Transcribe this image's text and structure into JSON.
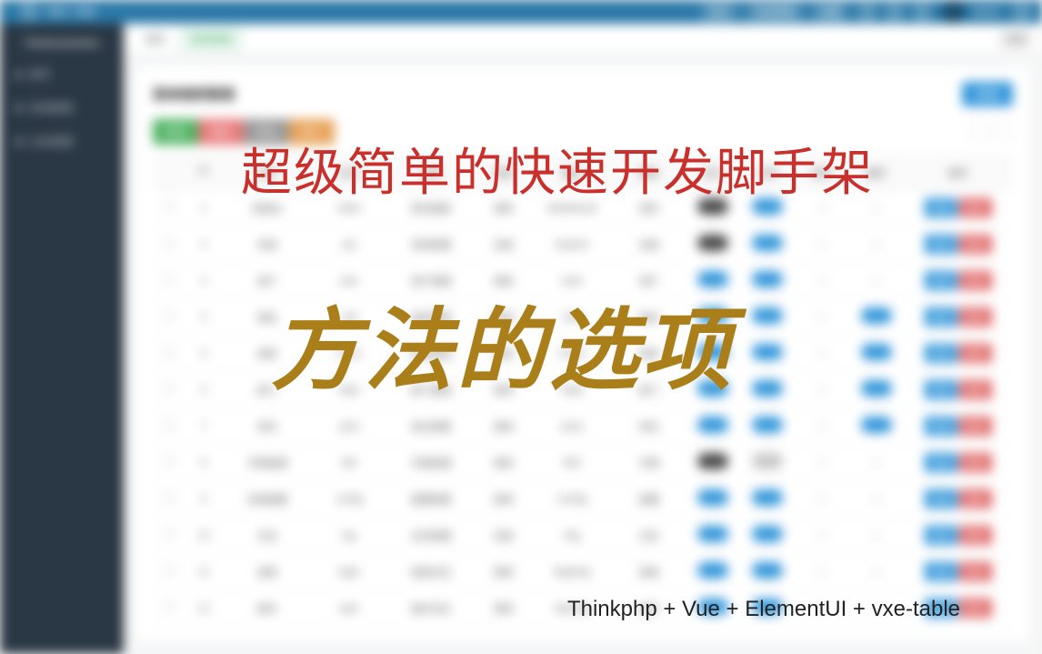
{
  "topbar": {
    "btn1": "首页",
    "btn2": "系统管理",
    "btn3": "设置",
    "username": "admin"
  },
  "sidebar": {
    "logo": "ThinkVueAdmin",
    "items": [
      "首页",
      "系统管理",
      "日志管理"
    ]
  },
  "tabs": {
    "t1": "首页",
    "t2": "菜单管理",
    "close": "关闭"
  },
  "panel": {
    "title": "菜单规则管理",
    "primary": "新增"
  },
  "toolbar": {
    "g": "新增",
    "r": "删除",
    "gr": "导出",
    "o": "导入"
  },
  "columns": [
    "",
    "ID",
    "名称",
    "标识",
    "权限",
    "类型",
    "路由",
    "图标",
    "显示",
    "状态",
    "排序",
    "缓存",
    "操作"
  ],
  "rows": [
    {
      "id": "1",
      "name": "控制台",
      "ident": "index",
      "perm": "首页面板",
      "type": "菜单",
      "route": "/dashboard",
      "icon": "首页",
      "c8": "dark",
      "c9": "on",
      "c10": "—",
      "c11": "—"
    },
    {
      "id": "2",
      "name": "系统",
      "ident": "sys",
      "perm": "系统管理",
      "type": "目录",
      "route": "/system",
      "icon": "系统",
      "c8": "dark",
      "c9": "on",
      "c10": "—",
      "c11": "—"
    },
    {
      "id": "3",
      "name": "用户",
      "ident": "user",
      "perm": "用户管理",
      "type": "菜单",
      "route": "/user",
      "icon": "用户",
      "c8": "on",
      "c9": "on",
      "c10": "—",
      "c11": "—"
    },
    {
      "id": "4",
      "name": "角色",
      "ident": "role",
      "perm": "角色管理",
      "type": "菜单",
      "route": "/role",
      "icon": "角色",
      "c8": "on",
      "c9": "on",
      "c10": "—",
      "c11": "on"
    },
    {
      "id": "5",
      "name": "菜单",
      "ident": "menu",
      "perm": "菜单管理",
      "type": "菜单",
      "route": "/menu",
      "icon": "菜单",
      "c8": "on",
      "c9": "on",
      "c10": "—",
      "c11": "on"
    },
    {
      "id": "6",
      "name": "部门",
      "ident": "dept",
      "perm": "部门管理",
      "type": "菜单",
      "route": "/dept",
      "icon": "部门",
      "c8": "on",
      "c9": "on",
      "c10": "—",
      "c11": "on"
    },
    {
      "id": "7",
      "name": "岗位",
      "ident": "post",
      "perm": "岗位管理",
      "type": "菜单",
      "route": "/post",
      "icon": "岗位",
      "c8": "on",
      "c9": "on",
      "c10": "—",
      "c11": "on"
    },
    {
      "id": "8",
      "name": "字典管理",
      "ident": "dict",
      "perm": "字典管理",
      "type": "菜单",
      "route": "/dict",
      "icon": "字典",
      "c8": "dark",
      "c9": "off",
      "c10": "—",
      "c11": "—"
    },
    {
      "id": "9",
      "name": "系统配置",
      "ident": "config",
      "perm": "配置管理",
      "type": "菜单",
      "route": "/config",
      "icon": "配置",
      "c8": "on",
      "c9": "on",
      "c10": "—",
      "c11": "—"
    },
    {
      "id": "10",
      "name": "日志",
      "ident": "log",
      "perm": "日志管理",
      "type": "目录",
      "route": "/log",
      "icon": "日志",
      "c8": "on",
      "c9": "on",
      "c10": "—",
      "c11": "—"
    },
    {
      "id": "11",
      "name": "登录",
      "ident": "login",
      "perm": "登录日志",
      "type": "菜单",
      "route": "/loginlog",
      "icon": "登录",
      "c8": "on",
      "c9": "on",
      "c10": "—",
      "c11": "—"
    },
    {
      "id": "12",
      "name": "操作",
      "ident": "oper",
      "perm": "操作日志",
      "type": "菜单",
      "route": "/operlog",
      "icon": "操作",
      "c8": "on",
      "c9": "on",
      "c10": "—",
      "c11": "—"
    }
  ],
  "ops": {
    "edit": "修改",
    "del": "删除"
  },
  "overlay": {
    "line1": "超级简单的快速开发脚手架",
    "line2": "方法的选项",
    "line3": "Thinkphp + Vue + ElementUI + vxe-table"
  }
}
